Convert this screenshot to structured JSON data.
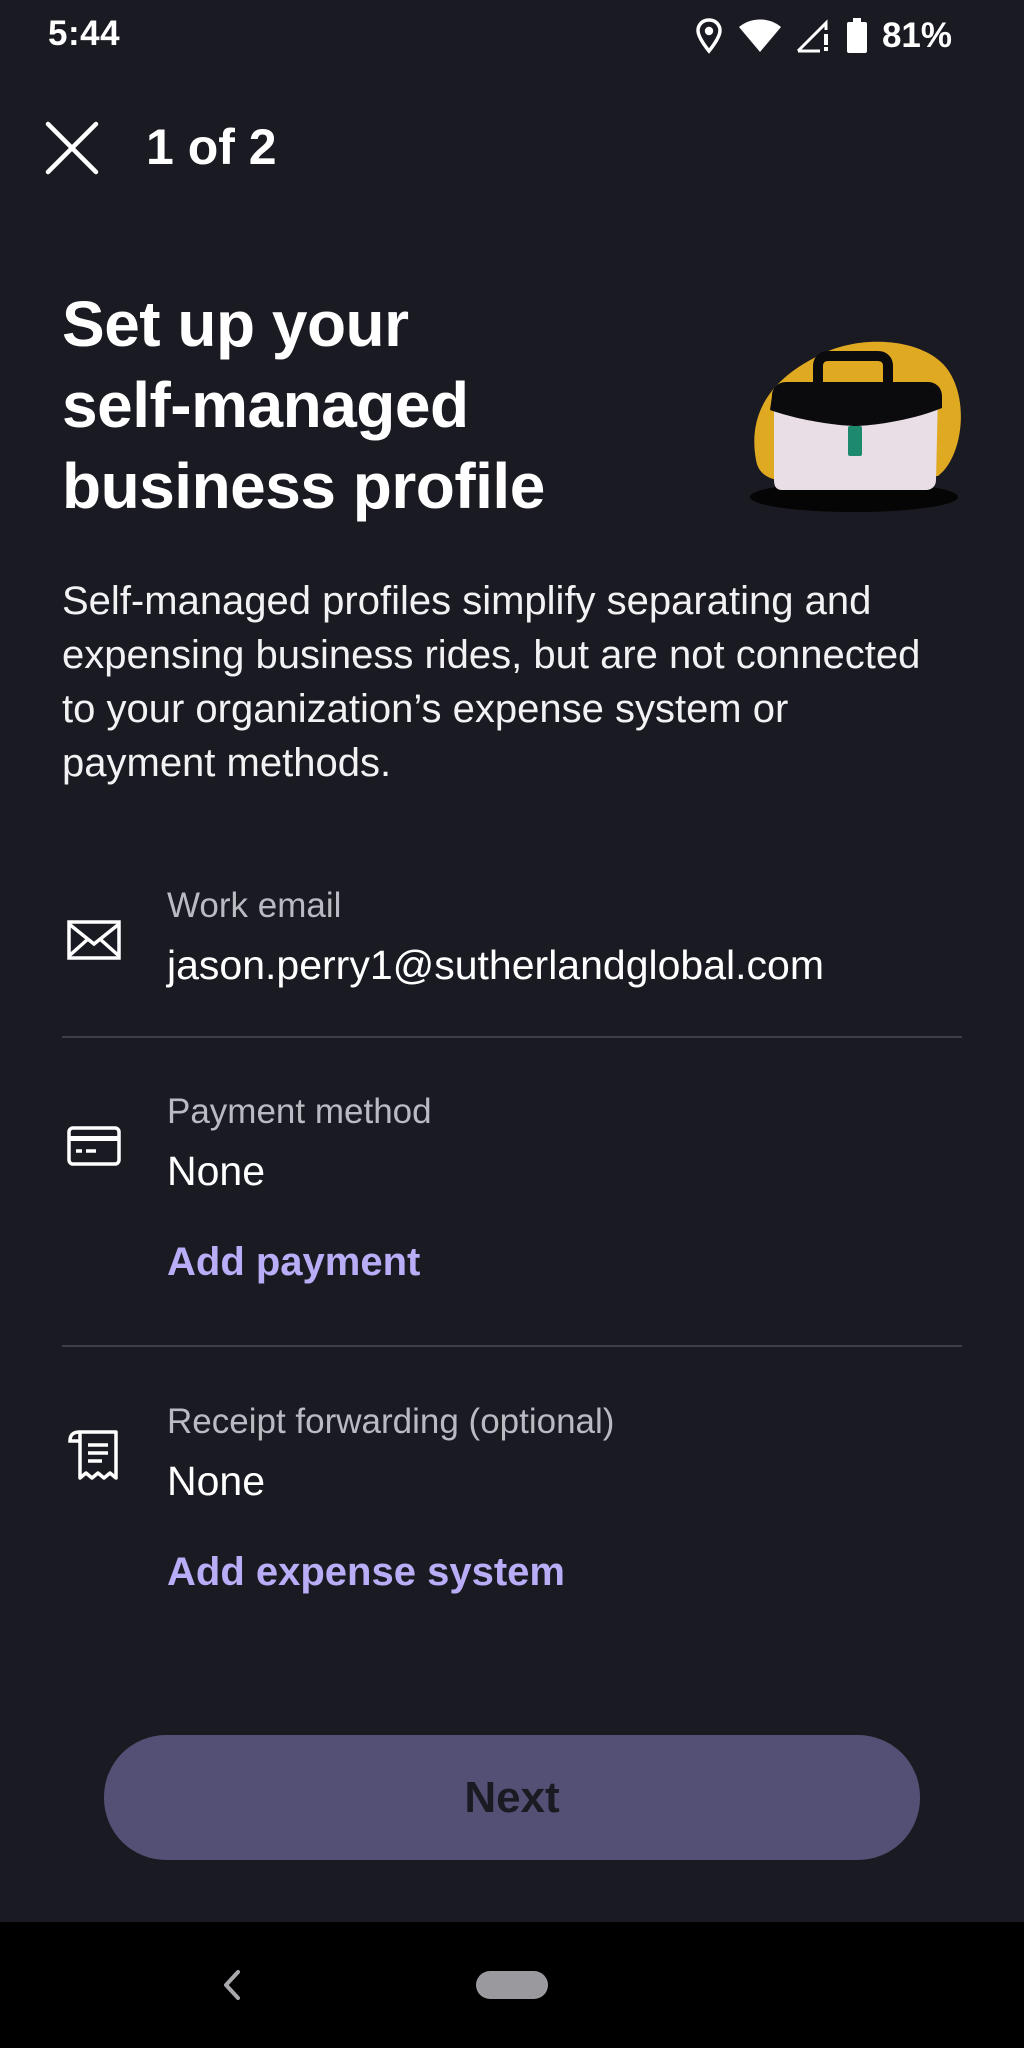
{
  "status_bar": {
    "time": "5:44",
    "battery": "81%",
    "icons": [
      "location-icon",
      "wifi-icon",
      "cell-signal-icon",
      "battery-icon"
    ]
  },
  "header": {
    "close_icon": "close-icon",
    "step": "1 of 2"
  },
  "title": {
    "line1": "Set up your",
    "line2": "self-managed",
    "line3": "business profile"
  },
  "illustration": {
    "icon": "briefcase-icon",
    "colors": {
      "blob": "#e0a922",
      "case_body": "#e9dde6",
      "case_flap": "#0b0b0d",
      "clasp": "#1d8a6d"
    }
  },
  "description": "Self-managed profiles simplify separating and expensing business rides, but are not connected to your organization’s expense system or payment methods.",
  "fields": {
    "email": {
      "icon": "mail-icon",
      "label": "Work email",
      "value": "jason.perry1@sutherlandglobal.com"
    },
    "payment": {
      "icon": "credit-card-icon",
      "label": "Payment method",
      "value": "None",
      "action": "Add payment"
    },
    "receipt": {
      "icon": "receipt-icon",
      "label": "Receipt forwarding (optional)",
      "value": "None",
      "action": "Add expense system"
    }
  },
  "footer": {
    "next_label": "Next"
  },
  "nav": {
    "back_icon": "back-chevron-icon",
    "home_icon": "home-pill-icon"
  },
  "colors": {
    "background": "#1a1b22",
    "accent_link": "#b8adf6",
    "button_disabled": "#544f74",
    "divider": "#3d3e46"
  }
}
